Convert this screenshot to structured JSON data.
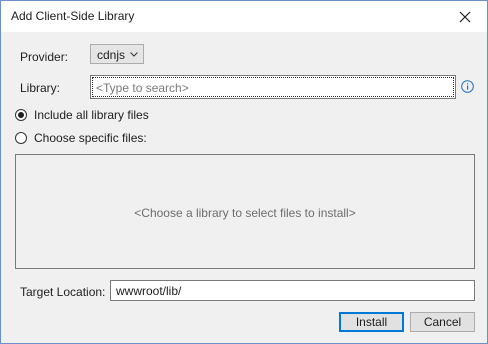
{
  "window": {
    "title": "Add Client-Side Library"
  },
  "provider": {
    "label": "Provider:",
    "selected": "cdnjs"
  },
  "library": {
    "label": "Library:",
    "placeholder": "<Type to search>"
  },
  "file_options": {
    "include_all": {
      "label": "Include all library files",
      "checked": true
    },
    "choose_specific": {
      "label": "Choose specific files:",
      "checked": false
    }
  },
  "files_panel": {
    "message": "<Choose a library to select files to install>"
  },
  "target": {
    "label": "Target Location:",
    "value": "wwwroot/lib/"
  },
  "buttons": {
    "install": "Install",
    "cancel": "Cancel"
  },
  "colors": {
    "accent": "#0078d7",
    "info_icon": "#1f6fbf"
  }
}
